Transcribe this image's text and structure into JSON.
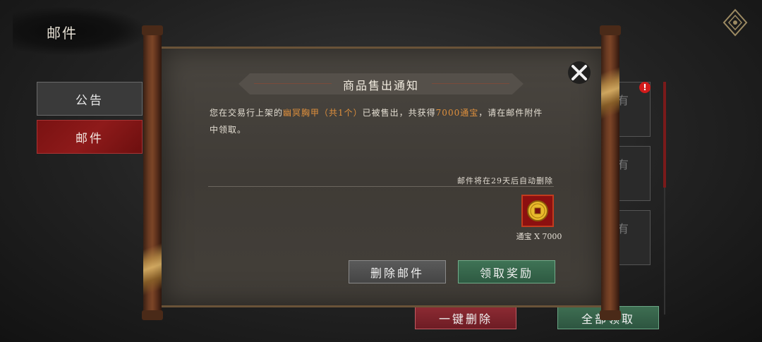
{
  "header": {
    "title": "邮件"
  },
  "sidebar": {
    "items": [
      {
        "label": "公告",
        "active": false
      },
      {
        "label": "邮件",
        "active": true
      }
    ]
  },
  "mail_list": {
    "partial_char": "有",
    "badge": "!"
  },
  "bottom_actions": {
    "delete_all": "一键删除",
    "claim_all": "全部领取"
  },
  "dialog": {
    "title": "商品售出通知",
    "body": {
      "part1": "您在交易行上架的",
      "item_name": "幽冥胸甲（共1个）",
      "part2": "已被售出，共获得",
      "reward_text": "7000通宝",
      "part3": "，请在邮件附件中领取。"
    },
    "expire_note": "邮件将在29天后自动删除",
    "attachment": {
      "icon": "copper-coin-icon",
      "caption": "通宝 X 7000"
    },
    "buttons": {
      "delete": "删除邮件",
      "claim": "领取奖励"
    }
  },
  "colors": {
    "highlight": "#e0903c",
    "tab_active": "#8e1a1a",
    "claim_green": "#3e6e52",
    "delete_red": "#8d2b33"
  }
}
